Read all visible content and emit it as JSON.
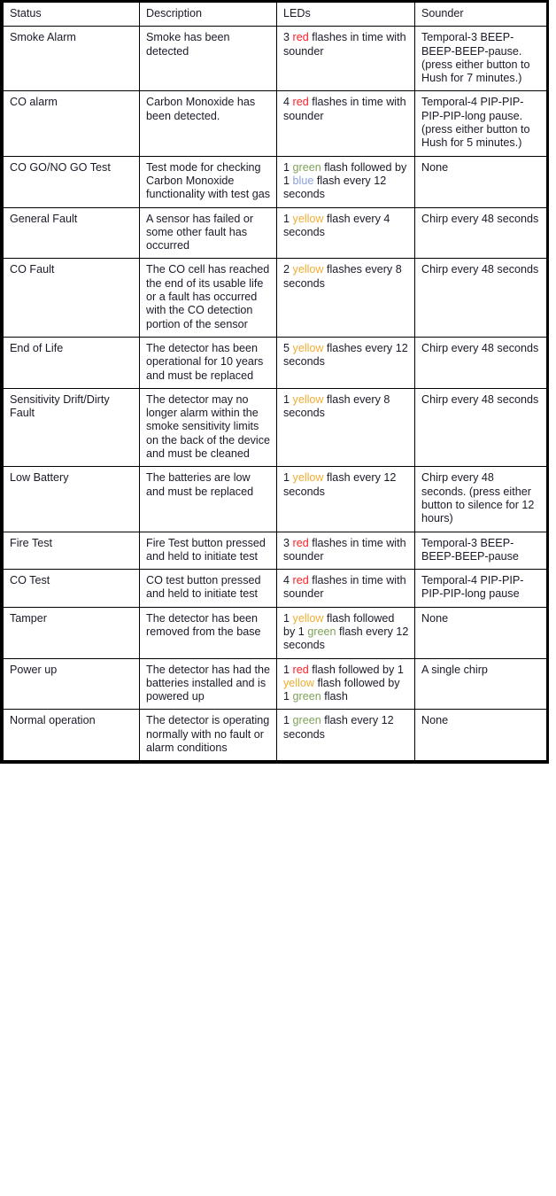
{
  "table": {
    "name": "detector-status-indication-table",
    "columns": [
      "Status",
      "Description",
      "LEDs",
      "Sounder"
    ],
    "color_keywords": {
      "red": "#ff1d25",
      "green": "#7fa05a",
      "yellow": "#f0ad33",
      "blue": "#8c9fe0"
    },
    "rows": [
      {
        "status": "Smoke Alarm",
        "description": "Smoke has been detected",
        "leds": [
          {
            "text": "3 ",
            "color": null
          },
          {
            "text": "red",
            "color": "red"
          },
          {
            "text": " flashes in time with sounder",
            "color": null
          }
        ],
        "sounder": "Temporal-3 BEEP-BEEP-BEEP-pause. (press either button to Hush for 7 minutes.)"
      },
      {
        "status": "CO alarm",
        "description": "Carbon Monoxide has been detected.",
        "leds": [
          {
            "text": "4 ",
            "color": null
          },
          {
            "text": "red",
            "color": "red"
          },
          {
            "text": " flashes in time with sounder",
            "color": null
          }
        ],
        "sounder": "Temporal-4 PIP-PIP-PIP-PIP-long pause. (press either button to Hush for 5 minutes.)"
      },
      {
        "status": "CO GO/NO GO Test",
        "description": "Test mode for checking Carbon Monoxide functionality with test gas",
        "leds": [
          {
            "text": "1 ",
            "color": null
          },
          {
            "text": "green",
            "color": "green"
          },
          {
            "text": " flash followed by 1 ",
            "color": null
          },
          {
            "text": "blue",
            "color": "blue"
          },
          {
            "text": " flash every 12 seconds",
            "color": null
          }
        ],
        "sounder": "None"
      },
      {
        "status": "General Fault",
        "description": "A sensor has failed or some other fault has occurred",
        "leds": [
          {
            "text": "1 ",
            "color": null
          },
          {
            "text": "yellow",
            "color": "yellow"
          },
          {
            "text": " flash every 4 seconds",
            "color": null
          }
        ],
        "sounder": "Chirp every 48 seconds"
      },
      {
        "status": "CO Fault",
        "description": "The CO cell has reached the end of its usable life or a fault has occurred with the CO detection portion of the sensor",
        "leds": [
          {
            "text": "2 ",
            "color": null
          },
          {
            "text": "yellow",
            "color": "yellow"
          },
          {
            "text": " flashes every 8 seconds",
            "color": null
          }
        ],
        "sounder": "Chirp every 48 seconds"
      },
      {
        "status": "End of Life",
        "description": "The detector has been operational for 10 years and must be replaced",
        "leds": [
          {
            "text": "5 ",
            "color": null
          },
          {
            "text": "yellow",
            "color": "yellow"
          },
          {
            "text": " flashes every 12 seconds",
            "color": null
          }
        ],
        "sounder": "Chirp every 48 seconds"
      },
      {
        "status": "Sensitivity Drift/Dirty Fault",
        "description": "The detector may no longer alarm within the smoke sensitivity limits on the back of the device and must be cleaned",
        "leds": [
          {
            "text": "1 ",
            "color": null
          },
          {
            "text": "yellow",
            "color": "yellow"
          },
          {
            "text": " flash every 8 seconds",
            "color": null
          }
        ],
        "sounder": "Chirp every 48 seconds"
      },
      {
        "status": "Low Battery",
        "description": "The batteries are low and must be replaced",
        "leds": [
          {
            "text": "1 ",
            "color": null
          },
          {
            "text": "yellow",
            "color": "yellow"
          },
          {
            "text": " flash every 12 seconds",
            "color": null
          }
        ],
        "sounder": "Chirp every 48 seconds. (press either button to silence for 12 hours)"
      },
      {
        "status": "Fire Test",
        "description": "Fire Test button pressed and held to initiate test",
        "leds": [
          {
            "text": "3 ",
            "color": null
          },
          {
            "text": "red",
            "color": "red"
          },
          {
            "text": " flashes in time with sounder",
            "color": null
          }
        ],
        "sounder": "Temporal-3 BEEP-BEEP-BEEP-pause"
      },
      {
        "status": "CO Test",
        "description": "CO test button pressed and held to initiate test",
        "leds": [
          {
            "text": "4 ",
            "color": null
          },
          {
            "text": "red",
            "color": "red"
          },
          {
            "text": " flashes in time with sounder",
            "color": null
          }
        ],
        "sounder": "Temporal-4 PIP-PIP-PIP-PIP-long pause"
      },
      {
        "status": "Tamper",
        "description": "The detector has been removed from the base",
        "leds": [
          {
            "text": "1 ",
            "color": null
          },
          {
            "text": "yellow",
            "color": "yellow"
          },
          {
            "text": " flash followed by 1 ",
            "color": null
          },
          {
            "text": "green",
            "color": "green"
          },
          {
            "text": " flash every 12 seconds",
            "color": null
          }
        ],
        "sounder": "None"
      },
      {
        "status": "Power up",
        "description": "The detector has had the batteries installed and is powered up",
        "leds": [
          {
            "text": "1 ",
            "color": null
          },
          {
            "text": "red",
            "color": "red"
          },
          {
            "text": " flash followed by 1 ",
            "color": null
          },
          {
            "text": "yellow",
            "color": "yellow"
          },
          {
            "text": " flash followed by 1 ",
            "color": null
          },
          {
            "text": "green",
            "color": "green"
          },
          {
            "text": " flash",
            "color": null
          }
        ],
        "sounder": "A single chirp"
      },
      {
        "status": "Normal operation",
        "description": "The detector is operating normally with no fault or alarm conditions",
        "leds": [
          {
            "text": "1 ",
            "color": null
          },
          {
            "text": "green",
            "color": "green"
          },
          {
            "text": " flash every 12 seconds",
            "color": null
          }
        ],
        "sounder": "None"
      }
    ]
  }
}
